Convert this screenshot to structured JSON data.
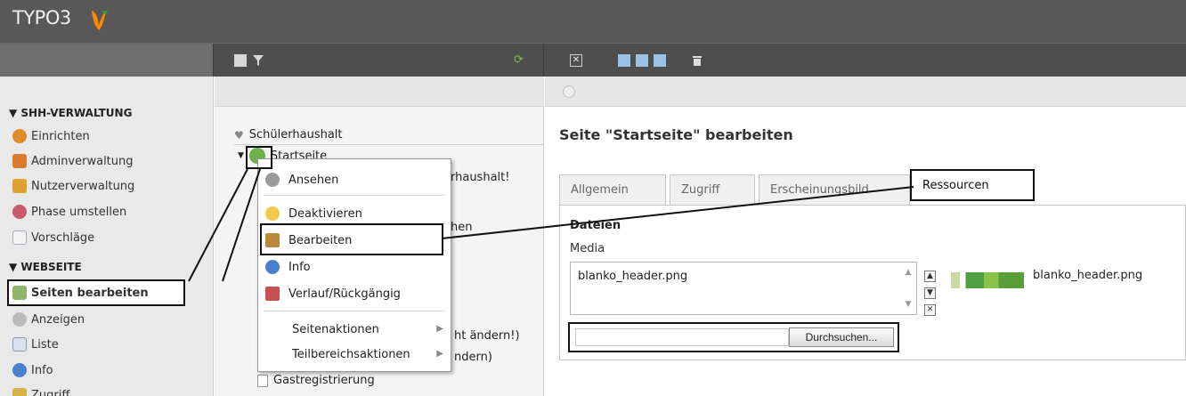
{
  "app": {
    "logo_text": "TYPO3",
    "brand_color": "#ff8700"
  },
  "module_menu": {
    "groups": [
      {
        "label": "▼ SHH-VERWALTUNG",
        "items": [
          {
            "label": "Einrichten",
            "icon": "setup-icon"
          },
          {
            "label": "Adminverwaltung",
            "icon": "admin-users-icon"
          },
          {
            "label": "Nutzerverwaltung",
            "icon": "users-icon"
          },
          {
            "label": "Phase umstellen",
            "icon": "phase-icon"
          },
          {
            "label": "Vorschläge",
            "icon": "document-icon"
          }
        ]
      },
      {
        "label": "▼ WEBSEITE",
        "items": [
          {
            "label": "Seiten bearbeiten",
            "icon": "page-edit-icon",
            "active": true
          },
          {
            "label": "Anzeigen",
            "icon": "eye-icon"
          },
          {
            "label": "Liste",
            "icon": "list-icon"
          },
          {
            "label": "Info",
            "icon": "info-icon"
          },
          {
            "label": "Zugriff",
            "icon": "lock-icon"
          }
        ]
      }
    ]
  },
  "tree": {
    "root": "Schülerhaushalt",
    "node": "Startseite",
    "partial": [
      "rhaushalt!",
      "hen",
      "ht ändern!)",
      "ndern)"
    ],
    "last": "Gastregistrierung"
  },
  "context_menu": {
    "items": [
      "Ansehen",
      "Deaktivieren",
      "Bearbeiten",
      "Info",
      "Verlauf/Rückgängig"
    ],
    "sub_items": [
      "Seitenaktionen",
      "Teilbereichsaktionen"
    ]
  },
  "content": {
    "title": "Seite \"Startseite\" bearbeiten",
    "tabs": [
      "Allgemein",
      "Zugriff",
      "Erscheinungsbild",
      "Ressourcen"
    ],
    "section": "Dateien",
    "field_label": "Media",
    "file_value": "blanko_header.png",
    "thumb_caption": "blanko_header.png",
    "browse_label": "Durchsuchen..."
  }
}
